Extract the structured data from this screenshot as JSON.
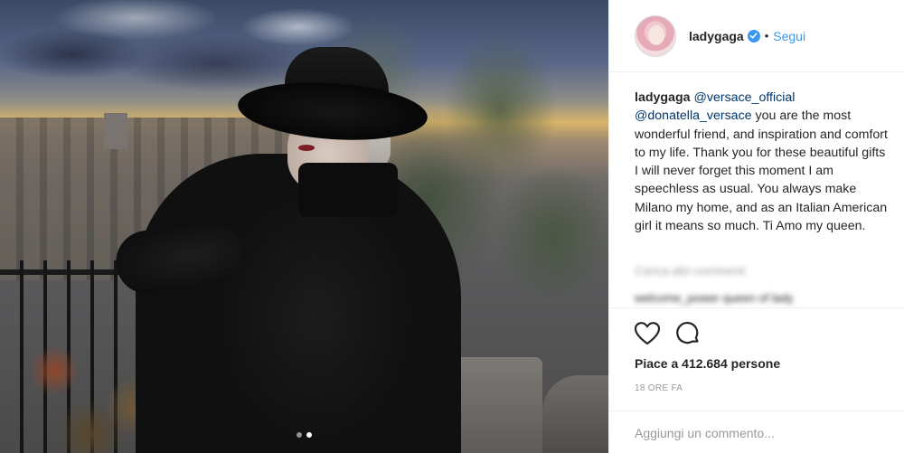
{
  "post": {
    "carousel_dots": 2,
    "active_dot_index": 1
  },
  "header": {
    "username": "ladygaga",
    "separator": "•",
    "follow_label": "Segui"
  },
  "caption": {
    "username": "ladygaga",
    "mention1": "@versace_official",
    "mention2": "@donatella_versace",
    "text": " you are the most wonderful friend, and inspiration and comfort to my life. Thank you for these beautiful gifts I will never forget this moment I am speechless as usual. You always make Milano my home, and as an Italian American girl it means so much. Ti Amo my queen."
  },
  "comments": {
    "load_more_label": "Carica altri commenti",
    "preview_comment": "welcome_power queen of lady"
  },
  "actions": {
    "likes_text": "Piace a 412.684 persone",
    "timestamp": "18 ORE FA"
  },
  "add_comment": {
    "placeholder": "Aggiungi un commento..."
  },
  "colors": {
    "accent": "#3897f0",
    "text": "#262626",
    "muted": "#999999",
    "mention": "#003569"
  }
}
